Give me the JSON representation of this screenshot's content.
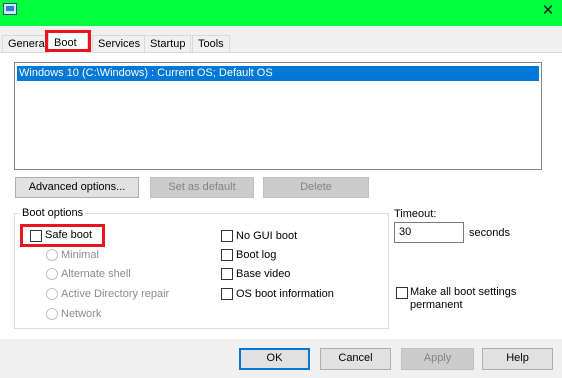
{
  "window": {
    "app_icon": "msconfig-icon",
    "close_glyph": "✕"
  },
  "tabs": [
    {
      "label": "General"
    },
    {
      "label": "Boot"
    },
    {
      "label": "Services"
    },
    {
      "label": "Startup"
    },
    {
      "label": "Tools"
    }
  ],
  "os_list": {
    "items": [
      "Windows 10 (C:\\Windows) : Current OS; Default OS"
    ]
  },
  "buttons": {
    "advanced": "Advanced options...",
    "set_default": "Set as default",
    "delete": "Delete"
  },
  "boot_options": {
    "title": "Boot options",
    "safe_boot": "Safe boot",
    "minimal": "Minimal",
    "alternate_shell": "Alternate shell",
    "ad_repair": "Active Directory repair",
    "network": "Network",
    "no_gui": "No GUI boot",
    "boot_log": "Boot log",
    "base_video": "Base video",
    "os_boot_info": "OS boot information"
  },
  "timeout": {
    "label": "Timeout:",
    "value": "30",
    "unit": "seconds"
  },
  "permanent": {
    "line1": "Make all boot settings",
    "line2": "permanent"
  },
  "footer": {
    "ok": "OK",
    "cancel": "Cancel",
    "apply": "Apply",
    "help": "Help"
  },
  "colors": {
    "titlebar": "#00ff3c",
    "selection": "#0078d7",
    "highlight": "#e8141e"
  }
}
